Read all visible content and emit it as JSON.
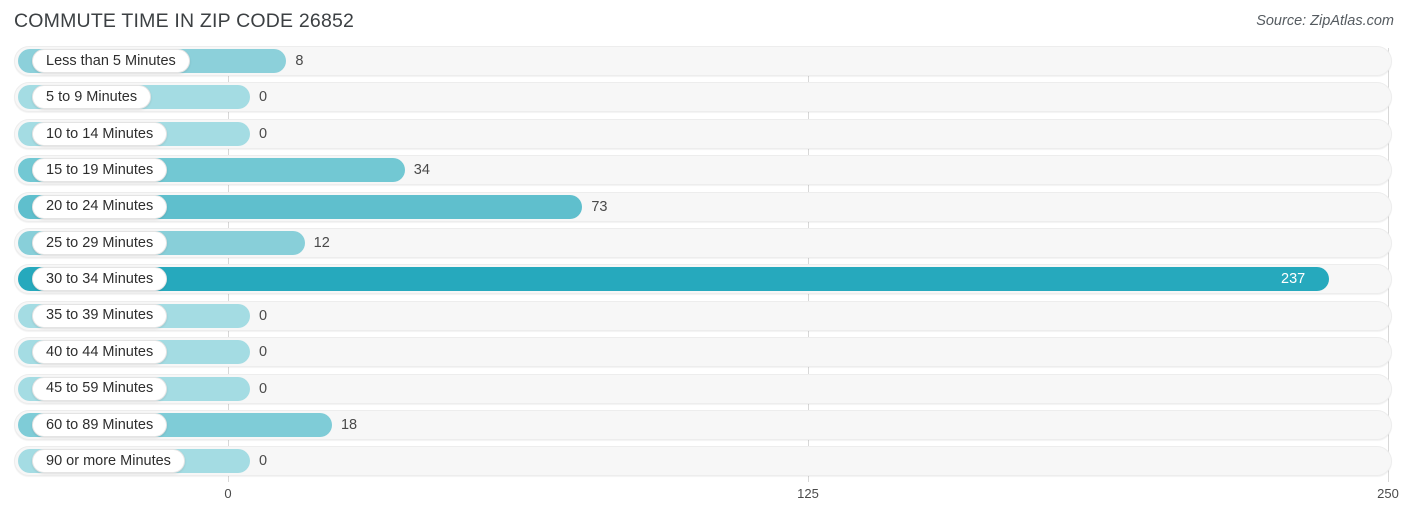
{
  "header": {
    "title": "COMMUTE TIME IN ZIP CODE 26852",
    "source": "Source: ZipAtlas.com"
  },
  "chart_data": {
    "type": "bar",
    "orientation": "horizontal",
    "title": "COMMUTE TIME IN ZIP CODE 26852",
    "xlabel": "",
    "ylabel": "",
    "xlim": [
      0,
      250
    ],
    "xticks": [
      0,
      125,
      250
    ],
    "xtick_labels": [
      "0",
      "125",
      "250"
    ],
    "grid": true,
    "legend": false,
    "categories": [
      "Less than 5 Minutes",
      "5 to 9 Minutes",
      "10 to 14 Minutes",
      "15 to 19 Minutes",
      "20 to 24 Minutes",
      "25 to 29 Minutes",
      "30 to 34 Minutes",
      "35 to 39 Minutes",
      "40 to 44 Minutes",
      "45 to 59 Minutes",
      "60 to 89 Minutes",
      "90 or more Minutes"
    ],
    "values": [
      8,
      0,
      0,
      34,
      73,
      12,
      237,
      0,
      0,
      0,
      18,
      0
    ],
    "value_labels": [
      "8",
      "0",
      "0",
      "34",
      "73",
      "12",
      "237",
      "0",
      "0",
      "0",
      "18",
      "0"
    ],
    "bar_colors": [
      "#8cd0da",
      "#a4dce3",
      "#a4dce3",
      "#72c8d3",
      "#5fbfcd",
      "#88cfd9",
      "#26a9bd",
      "#a4dce3",
      "#a4dce3",
      "#a4dce3",
      "#7fccd7",
      "#a4dce3"
    ],
    "track_color": "#f7f7f7",
    "label_pill_color": "#ffffff"
  }
}
